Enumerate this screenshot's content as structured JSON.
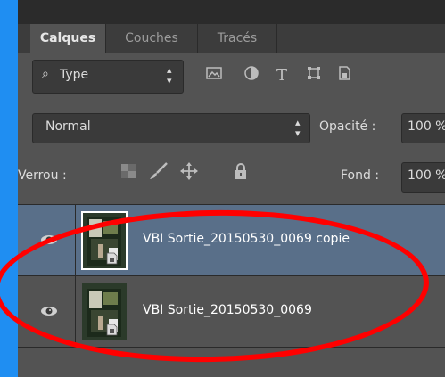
{
  "tabs": [
    "Calques",
    "Couches",
    "Tracés"
  ],
  "filter": {
    "label": "Type",
    "icons": [
      "image-filter-icon",
      "adjustment-filter-icon",
      "type-filter-icon",
      "shape-filter-icon",
      "smart-object-filter-icon"
    ]
  },
  "blend": {
    "mode": "Normal",
    "opacity_label": "Opacité :",
    "opacity_value": "100 %"
  },
  "lock": {
    "label": "Verrou :",
    "icons": [
      "lock-transparency-icon",
      "lock-pixels-icon",
      "lock-position-icon",
      "lock-all-icon"
    ],
    "fill_label": "Fond :",
    "fill_value": "100 %"
  },
  "layers": [
    {
      "name": "VBI Sortie_20150530_0069 copie",
      "selected": true
    },
    {
      "name": "VBI Sortie_20150530_0069",
      "selected": false
    }
  ],
  "colors": {
    "panel": "#535353",
    "selected_layer": "#596f89",
    "annotation": "#ff0000",
    "backdrop": "#1f8ef2"
  }
}
